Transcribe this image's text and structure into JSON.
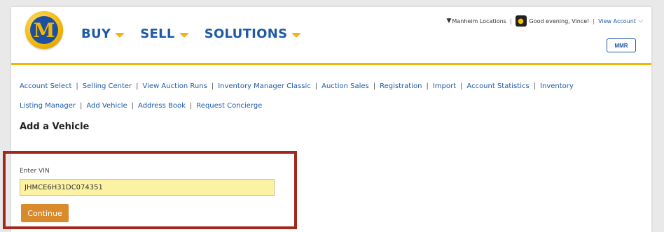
{
  "header": {
    "logo_letter": "M",
    "nav": [
      {
        "label": "BUY"
      },
      {
        "label": "SELL"
      },
      {
        "label": "SOLUTIONS"
      }
    ],
    "locations_label": "Manheim Locations",
    "greeting": "Good evening, Vince!",
    "view_account_label": "View Account",
    "mmr_label": "MMR"
  },
  "links": [
    "Account Select",
    "Selling Center",
    "View Auction Runs",
    "Inventory Manager Classic",
    "Auction Sales",
    "Registration",
    "Import",
    "Account Statistics",
    "Inventory",
    "Listing Manager",
    "Add Vehicle",
    "Address Book",
    "Request Concierge"
  ],
  "page_title": "Add a Vehicle",
  "vin": {
    "label": "Enter VIN",
    "value": "JHMCE6H31DC074351"
  },
  "continue_label": "Continue",
  "colors": {
    "brand_blue": "#1e5aa8",
    "brand_yellow": "#f2b705",
    "continue_orange": "#d98a2b",
    "highlight_red": "#a3281c",
    "input_fill": "#fbf3a3"
  }
}
